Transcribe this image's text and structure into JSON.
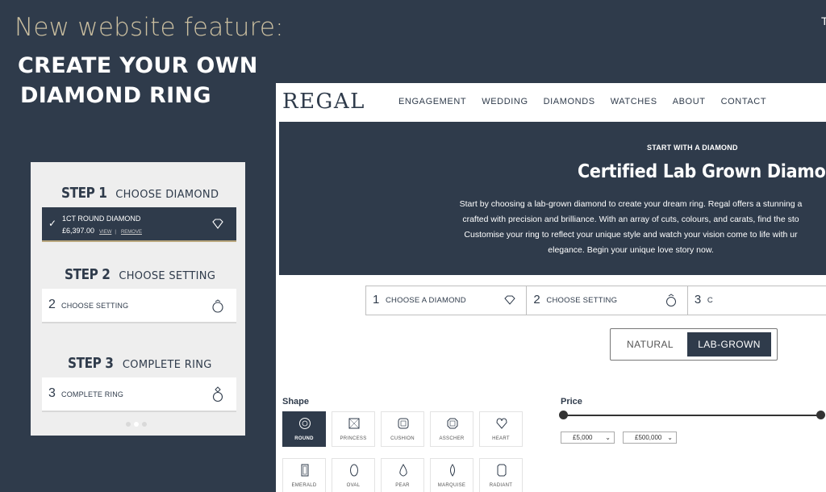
{
  "promo": {
    "feature_line": "New website feature:",
    "title_line1": "CREATE YOUR OWN",
    "title_line2": "DIAMOND RING",
    "corner_mark": "T"
  },
  "mobile": {
    "step1": {
      "num": "STEP 1",
      "title": "CHOOSE DIAMOND",
      "item": "1CT ROUND DIAMOND",
      "price": "£6,397.00",
      "view": "VIEW",
      "sep": "|",
      "remove": "REMOVE",
      "icon": "heart-icon"
    },
    "step2": {
      "num": "STEP 2",
      "title": "CHOOSE SETTING",
      "box_num": "2",
      "box_label": "CHOOSE SETTING",
      "icon": "ring-setting-icon"
    },
    "step3": {
      "num": "STEP 3",
      "title": "COMPLETE RING",
      "box_num": "3",
      "box_label": "COMPLETE RING",
      "icon": "diamond-ring-icon"
    }
  },
  "site": {
    "logo": "REGAL",
    "nav": [
      "ENGAGEMENT",
      "WEDDING",
      "DIAMONDS",
      "WATCHES",
      "ABOUT",
      "CONTACT"
    ],
    "hero": {
      "kicker": "START WITH A DIAMOND",
      "title": "Certified Lab Grown Diamonds",
      "lines": [
        "Start by choosing a lab-grown diamond to create your dream ring. Regal offers a stunning a",
        "crafted with precision and brilliance. With an array of cuts, colours, and carats, find the sto",
        "Customise your ring to reflect your unique style and watch your vision come to life with ur",
        "elegance. Begin your unique love story now."
      ]
    },
    "steps": [
      {
        "num": "1",
        "label": "CHOOSE A DIAMOND",
        "icon": "heart-icon"
      },
      {
        "num": "2",
        "label": "CHOOSE SETTING",
        "icon": "ring-setting-icon"
      },
      {
        "num": "3",
        "label": "C"
      }
    ],
    "toggle": {
      "natural": "NATURAL",
      "lab": "LAB-GROWN",
      "selected": "LAB-GROWN"
    },
    "shape_label": "Shape",
    "shapes": [
      "ROUND",
      "PRINCESS",
      "CUSHION",
      "ASSCHER",
      "HEART",
      "EMERALD",
      "OVAL",
      "PEAR",
      "MARQUISE",
      "RADIANT"
    ],
    "shape_selected": "ROUND",
    "price_label": "Price",
    "price_min": "£5,000",
    "price_max": "£500,000",
    "price_chevron": "⌄"
  },
  "colors": {
    "navy": "#2f3b4b",
    "gold": "#cbbfa0",
    "panel": "#eeeeee"
  }
}
